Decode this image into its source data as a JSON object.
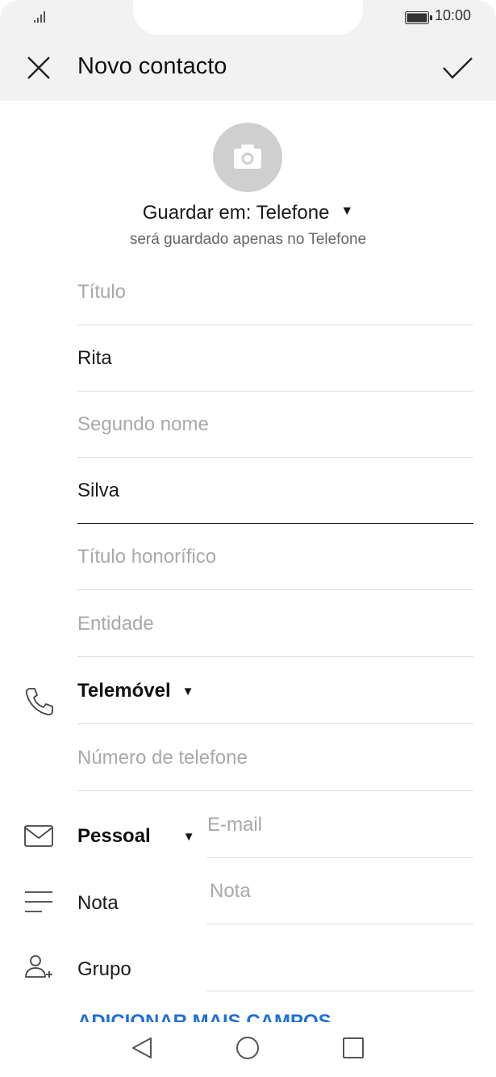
{
  "status_bar": {
    "time": "10:00"
  },
  "header": {
    "title": "Novo contacto"
  },
  "storage": {
    "label": "Guardar em: Telefone",
    "note": "será guardado apenas no Telefone"
  },
  "fields": {
    "titulo": {
      "placeholder": "Título"
    },
    "first_name": {
      "value": "Rita"
    },
    "middle_name": {
      "placeholder": "Segundo nome"
    },
    "last_name": {
      "value": "Silva"
    },
    "honorific": {
      "placeholder": "Título honorífico"
    },
    "entity": {
      "placeholder": "Entidade"
    }
  },
  "phone": {
    "type_label": "Telemóvel",
    "number_placeholder": "Número de telefone"
  },
  "email": {
    "type_label": "Pessoal",
    "placeholder": "E-mail"
  },
  "note": {
    "label": "Nota",
    "placeholder": "Nota"
  },
  "group": {
    "label": "Grupo"
  },
  "add_more": {
    "label": "ADICIONAR MAIS CAMPOS"
  }
}
